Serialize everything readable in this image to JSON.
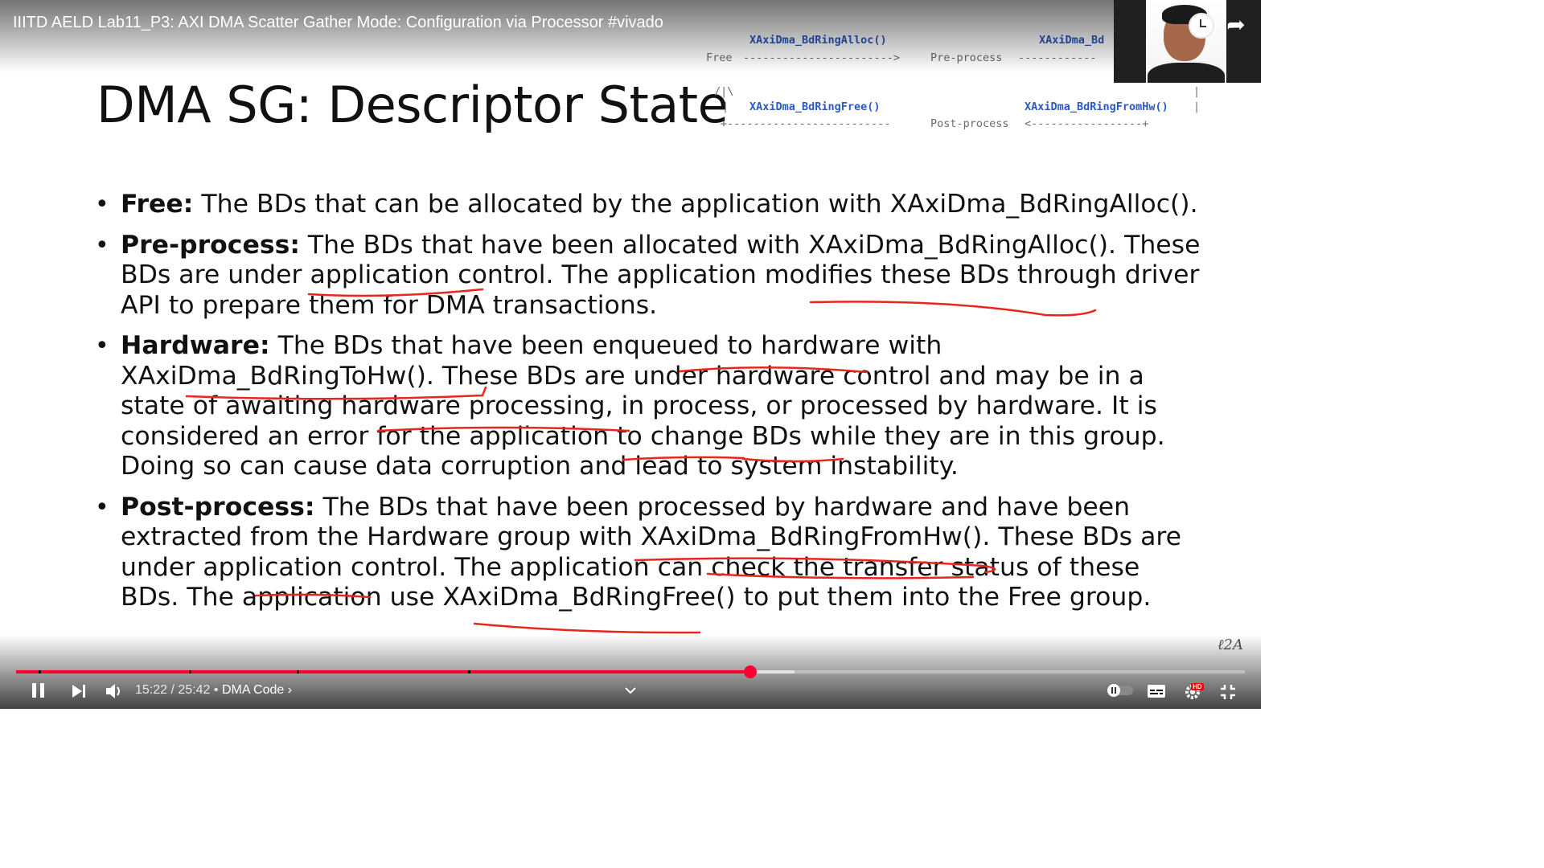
{
  "video": {
    "title": "IIITD AELD Lab11_P3: AXI DMA Scatter Gather Mode: Configuration via Processor #vivado"
  },
  "slide": {
    "title": "DMA SG: Descriptor State",
    "diagram": {
      "fn_alloc": "XAxiDma_BdRingAlloc()",
      "fn_tohw_partial": "XAxiDma_Bd",
      "state_free": "Free",
      "arrow_top_1": "----------------------->",
      "state_preprocess": "Pre-process",
      "arrow_top_2": "------------",
      "up_arrow": "/|\\",
      "pipe_left": "|",
      "pipe_right": "|",
      "fn_free": "XAxiDma_BdRingFree()",
      "fn_fromhw": "XAxiDma_BdRingFromHw()",
      "arrow_bottom_1": "+-------------------------",
      "state_postprocess": "Post-process",
      "arrow_bottom_2": "<-----------------+"
    },
    "bullets": [
      {
        "term": "Free:",
        "text": " The BDs that can be allocated by the application with XAxiDma_BdRingAlloc()."
      },
      {
        "term": "Pre-process:",
        "text": " The BDs that have been allocated with XAxiDma_BdRingAlloc(). These BDs are under application control. The application modifies these BDs through driver API to prepare them for DMA transactions."
      },
      {
        "term": "Hardware:",
        "text": " The BDs that have been enqueued to hardware with XAxiDma_BdRingToHw(). These BDs are under hardware control and may be in a state of awaiting hardware processing, in process, or processed by hardware. It is considered an error for the application to change BDs while they are in this group. Doing so can cause data corruption and lead to system instability."
      },
      {
        "term": "Post-process:",
        "text": " The BDs that have been processed by hardware and have been extracted from the Hardware group with XAxiDma_BdRingFromHw(). These BDs are under application control. The application can check the transfer status of these BDs. The application use XAxiDma_BdRingFree() to put them into the Free group."
      }
    ]
  },
  "player": {
    "current_time": "15:22",
    "separator": " / ",
    "duration": "25:42",
    "chapter_sep": " • ",
    "chapter": "DMA Code",
    "chapter_chevron": "›",
    "progress_fraction": 0.5978,
    "buffered_fraction": 0.6337,
    "hd_badge": "HD",
    "accent_color": "#ff0033"
  },
  "icons": {
    "pause": "pause-icon",
    "next": "next-icon",
    "volume": "volume-icon",
    "chevron": "chevron-down-icon",
    "autoplay": "autoplay-toggle-icon",
    "captions": "captions-icon",
    "settings": "settings-gear-icon",
    "fullscreen_exit": "exit-fullscreen-icon",
    "watch_later": "clock-icon",
    "share": "share-icon"
  },
  "annotation_color": "#e8261b"
}
